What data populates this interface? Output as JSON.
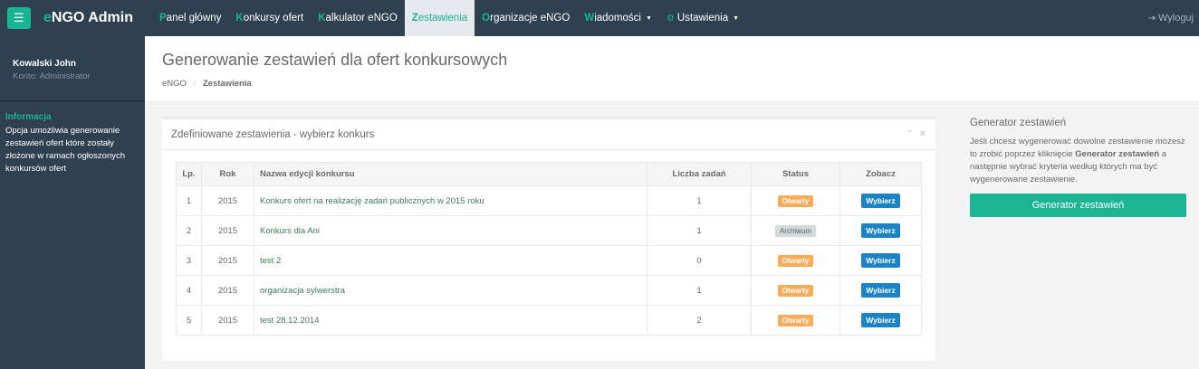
{
  "topbar": {
    "brand_e": "e",
    "brand_rest": "NGO Admin",
    "nav": [
      {
        "first": "P",
        "rest": "anel główny"
      },
      {
        "first": "K",
        "rest": "onkursy ofert"
      },
      {
        "first": "K",
        "rest": "alkulator eNGO"
      },
      {
        "first": "Z",
        "rest": "estawienia"
      },
      {
        "first": "O",
        "rest": "rganizacje eNGO"
      },
      {
        "first": "W",
        "rest": "iadomości"
      },
      {
        "first": "",
        "rest": "Ustawienia"
      }
    ],
    "logout": "Wyloguj"
  },
  "sidebar": {
    "user_name": "Kowalski John",
    "user_role": "Konto: Administrator",
    "info_title": "Informacja",
    "info_text": "Opcja umożliwia generowanie zestawień ofert które zostały złożone w ramach ogłoszonych konkursów ofert"
  },
  "header": {
    "title": "Generowanie zestawień dla ofert konkursowych",
    "crumb_root": "eNGO",
    "crumb_sep": "/",
    "crumb_current": "Zestawienia"
  },
  "panel": {
    "title": "Zdefiniowane zestawienia - wybierz konkurs",
    "collapse_glyph": "⌃",
    "close_glyph": "✕",
    "columns": [
      "Lp.",
      "Rok",
      "Nazwa edycji konkursu",
      "Liczba zadań",
      "Status",
      "Zobacz"
    ],
    "rows": [
      {
        "lp": "1",
        "rok": "2015",
        "name": "Konkurs ofert na realizację zadań publicznych w 2015 roku",
        "count": "1",
        "status": "Otwarty",
        "action": "Wybierz"
      },
      {
        "lp": "2",
        "rok": "2015",
        "name": "Konkurs dla Ani",
        "count": "1",
        "status": "Archiwum",
        "action": "Wybierz"
      },
      {
        "lp": "3",
        "rok": "2015",
        "name": "test 2",
        "count": "0",
        "status": "Otwarty",
        "action": "Wybierz"
      },
      {
        "lp": "4",
        "rok": "2015",
        "name": "organizacja sylwerstra",
        "count": "1",
        "status": "Otwarty",
        "action": "Wybierz"
      },
      {
        "lp": "5",
        "rok": "2015",
        "name": "test 28.12.2014",
        "count": "2",
        "status": "Otwarty",
        "action": "Wybierz"
      }
    ]
  },
  "generator": {
    "title": "Generator zestawień",
    "desc_1": "Jeśli chcesz wygenerować dowolne zestawienie możesz to zrobić poprzez kliknięcie ",
    "desc_bold": "Generator zestawień",
    "desc_2": " a następnie wybrać kryteria według których ma być wygenerowane zestawienie.",
    "button": "Generator zestawień"
  },
  "colors": {
    "navy": "#2f4050",
    "accent": "#1ab394",
    "warning": "#f8ac59",
    "primary_blue": "#1c84c6"
  }
}
